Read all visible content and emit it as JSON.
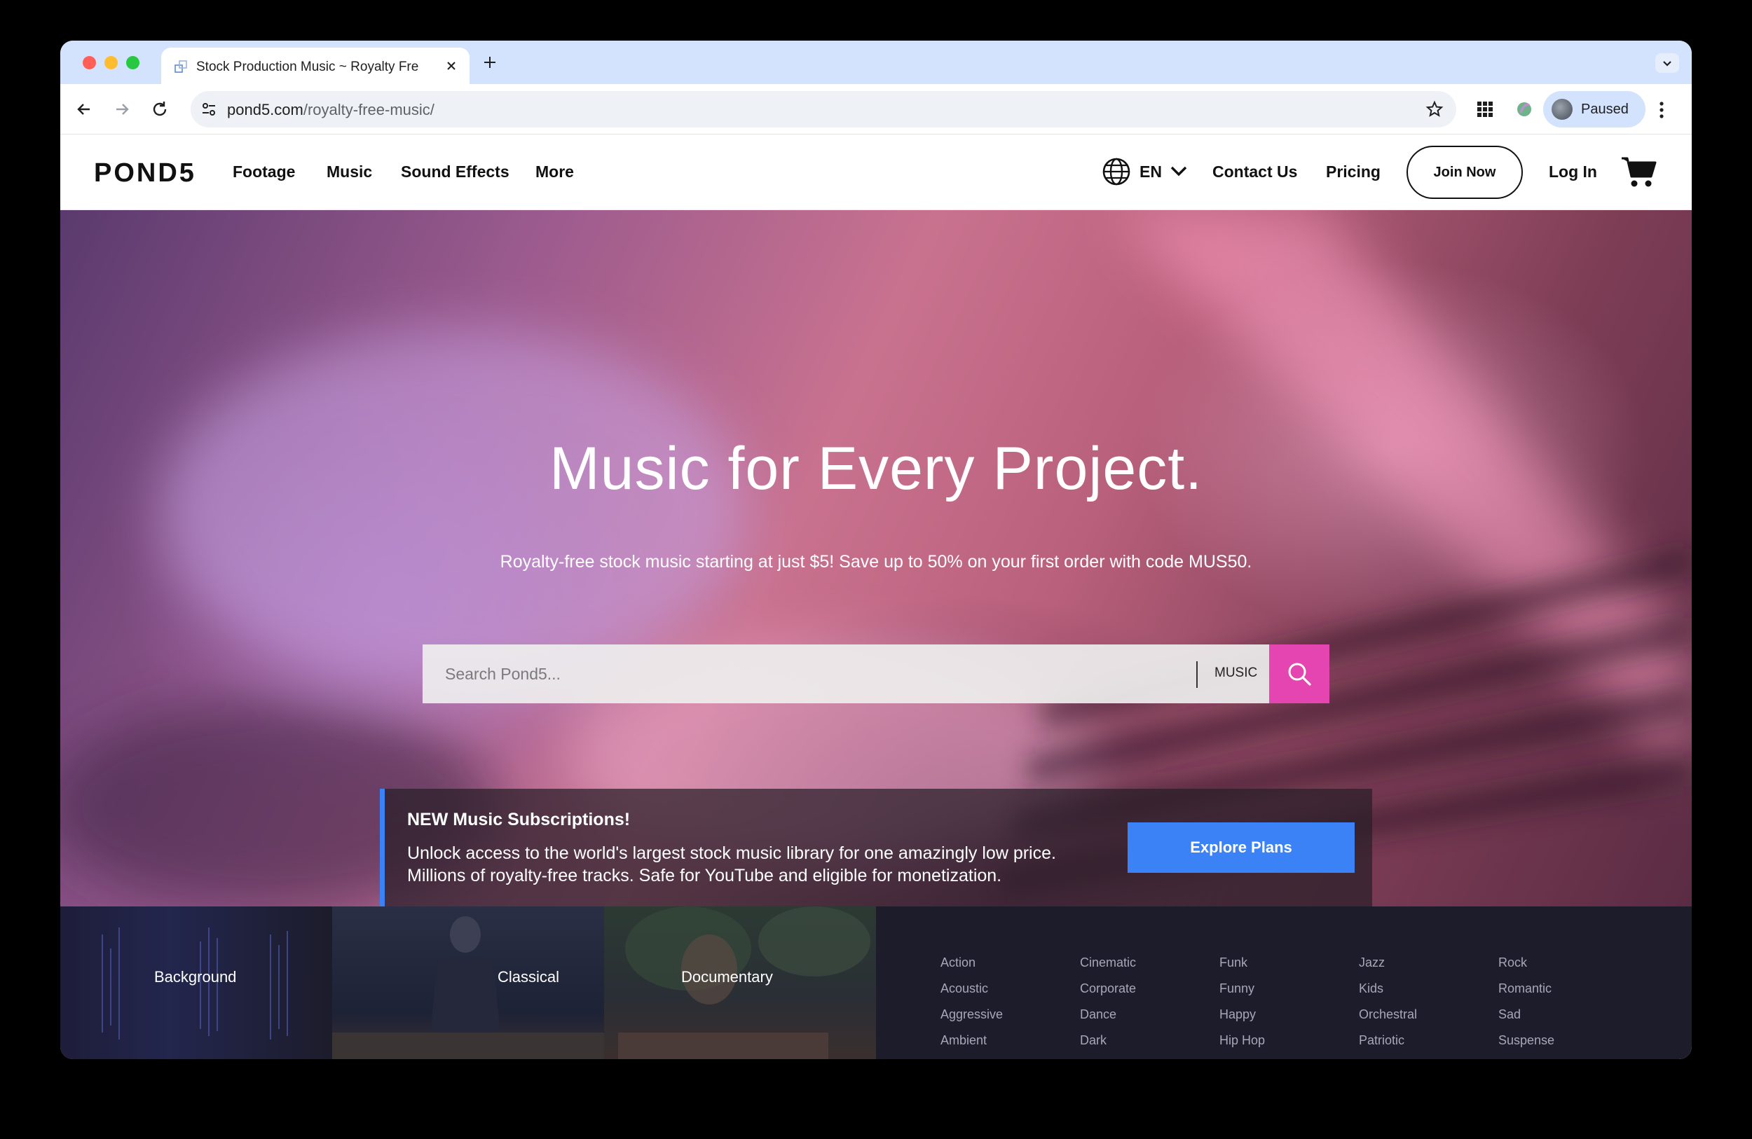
{
  "browser": {
    "tab_title": "Stock Production Music ~ Royalty Free Music",
    "url_domain": "pond5.com",
    "url_path": "/royalty-free-music/",
    "profile_label": "Paused"
  },
  "header": {
    "logo": "POND5",
    "nav": [
      "Footage",
      "Music",
      "Sound Effects",
      "More"
    ],
    "language": "EN",
    "contact": "Contact Us",
    "pricing": "Pricing",
    "join": "Join Now",
    "login": "Log In"
  },
  "hero": {
    "title": "Music for Every Project.",
    "subtitle": "Royalty-free stock music starting at just $5! Save up to 50% on your first order with code MUS50.",
    "search_placeholder": "Search Pond5...",
    "search_scope": "MUSIC"
  },
  "promo": {
    "title": "NEW Music Subscriptions!",
    "line1": "Unlock access to the world's largest stock music library for one amazingly low price.",
    "line2": "Millions of royalty-free tracks. Safe for YouTube and eligible for monetization.",
    "button": "Explore Plans"
  },
  "genres": {
    "tiles": [
      "Background",
      "Classical",
      "Documentary"
    ],
    "columns": [
      [
        "Action",
        "Acoustic",
        "Aggressive",
        "Ambient"
      ],
      [
        "Cinematic",
        "Corporate",
        "Dance",
        "Dark"
      ],
      [
        "Funk",
        "Funny",
        "Happy",
        "Hip Hop"
      ],
      [
        "Jazz",
        "Kids",
        "Orchestral",
        "Patriotic"
      ],
      [
        "Rock",
        "Romantic",
        "Sad",
        "Suspense"
      ]
    ]
  },
  "colors": {
    "accent_pink": "#e545b0",
    "accent_blue": "#3b82f6",
    "genre_bg": "#1c1c2b"
  }
}
